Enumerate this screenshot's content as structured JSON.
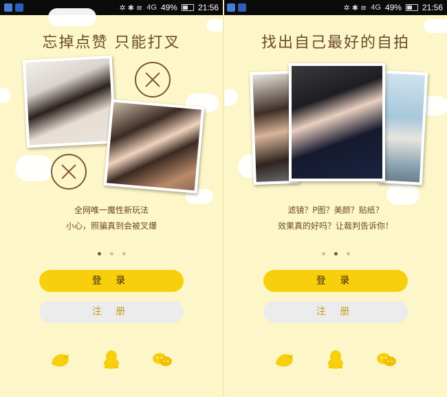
{
  "statusbar": {
    "battery": "49%",
    "time": "21:56",
    "network": "4G"
  },
  "panels": [
    {
      "title": "忘掉点赞 只能打叉",
      "tagline1": "全网唯一魔性新玩法",
      "tagline2": "小心，照骗真到会被叉爆",
      "login_label": "登 录",
      "register_label": "注 册"
    },
    {
      "title": "找出自己最好的自拍",
      "tagline1": "滤镜？P图？美颜？贴纸？",
      "tagline2": "效果真的好吗？让裁判告诉你！",
      "login_label": "登 录",
      "register_label": "注 册"
    }
  ],
  "colors": {
    "bg": "#fdf6c8",
    "accent": "#f8cf0c",
    "brown": "#6a4a2a",
    "register_bg": "#ececec"
  },
  "icons": [
    "bird-icon",
    "penguin-icon",
    "wechat-icon"
  ]
}
